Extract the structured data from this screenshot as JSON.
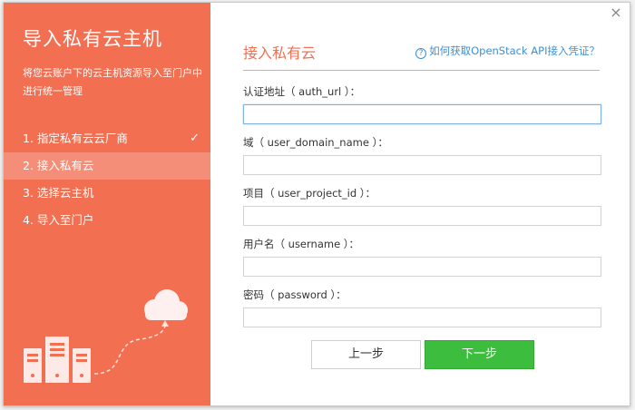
{
  "sidebar": {
    "title": "导入私有云主机",
    "description": "将您云账户下的云主机资源导入至门户中进行统一管理",
    "steps": [
      {
        "label": "1. 指定私有云云厂商",
        "done": true
      },
      {
        "label": "2. 接入私有云",
        "active": true
      },
      {
        "label": "3. 选择云主机"
      },
      {
        "label": "4. 导入至门户"
      }
    ],
    "check_glyph": "✓"
  },
  "dialog": {
    "close_glyph": "×"
  },
  "main": {
    "section_title": "接入私有云",
    "help_icon": "?",
    "help_link": "如何获取OpenStack API接入凭证？",
    "fields": [
      {
        "label": "认证地址（ auth_url ）：",
        "value": ""
      },
      {
        "label": "域（ user_domain_name ）：",
        "value": ""
      },
      {
        "label": "项目（ user_project_id ）：",
        "value": ""
      },
      {
        "label": "用户名（ username ）：",
        "value": ""
      },
      {
        "label": "密码（ password ）：",
        "value": ""
      }
    ]
  },
  "buttons": {
    "prev": "上一步",
    "next": "下一步"
  },
  "colors": {
    "accent": "#f26f52",
    "next_button": "#3dbd3d",
    "link": "#3c8fd6"
  }
}
